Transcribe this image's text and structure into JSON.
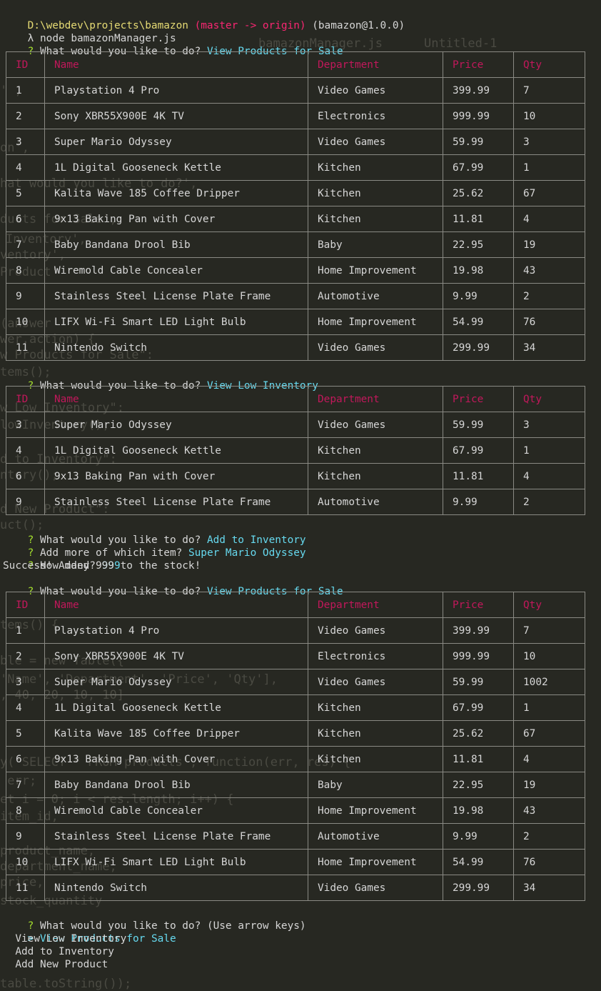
{
  "prompt": {
    "path": "D:\\webdev\\projects\\bamazon",
    "branch": "(master -> origin)",
    "package": "(bamazon@1.0.0)",
    "symbol": "λ",
    "command": "node bamazonManager.js"
  },
  "ghost_tabs": [
    "bamazonManager.js",
    "Untitled-1"
  ],
  "columns": [
    "ID",
    "Name",
    "Department",
    "Price",
    "Qty"
  ],
  "q_mark": "?",
  "sessions": {
    "q1": {
      "question": "What would you like to do?",
      "answer": "View Products for Sale"
    },
    "q2": {
      "question": "What would you like to do?",
      "answer": "View Low Inventory"
    },
    "q3": {
      "question": "What would you like to do?",
      "answer": "Add to Inventory"
    },
    "q4": {
      "question": "Add more of which item?",
      "answer": "Super Mario Odyssey"
    },
    "q5": {
      "question": "How many?",
      "answer": "999"
    },
    "success": "Success! Added 999 to the stock!",
    "q6": {
      "question": "What would you like to do?",
      "answer": "View Products for Sale"
    },
    "q7": {
      "question": "What would you like to do?",
      "hint": "(Use arrow keys)"
    }
  },
  "tables": {
    "products_1": [
      [
        "1",
        "Playstation 4 Pro",
        "Video Games",
        "399.99",
        "7"
      ],
      [
        "2",
        "Sony XBR55X900E 4K TV",
        "Electronics",
        "999.99",
        "10"
      ],
      [
        "3",
        "Super Mario Odyssey",
        "Video Games",
        "59.99",
        "3"
      ],
      [
        "4",
        "1L Digital Gooseneck Kettle",
        "Kitchen",
        "67.99",
        "1"
      ],
      [
        "5",
        "Kalita Wave 185 Coffee Dripper",
        "Kitchen",
        "25.62",
        "67"
      ],
      [
        "6",
        "9x13 Baking Pan with Cover",
        "Kitchen",
        "11.81",
        "4"
      ],
      [
        "7",
        "Baby Bandana Drool Bib",
        "Baby",
        "22.95",
        "19"
      ],
      [
        "8",
        "Wiremold Cable Concealer",
        "Home Improvement",
        "19.98",
        "43"
      ],
      [
        "9",
        "Stainless Steel License Plate Frame",
        "Automotive",
        "9.99",
        "2"
      ],
      [
        "10",
        "LIFX Wi-Fi Smart LED Light Bulb",
        "Home Improvement",
        "54.99",
        "76"
      ],
      [
        "11",
        "Nintendo Switch",
        "Video Games",
        "299.99",
        "34"
      ]
    ],
    "low_inventory": [
      [
        "3",
        "Super Mario Odyssey",
        "Video Games",
        "59.99",
        "3"
      ],
      [
        "4",
        "1L Digital Gooseneck Kettle",
        "Kitchen",
        "67.99",
        "1"
      ],
      [
        "6",
        "9x13 Baking Pan with Cover",
        "Kitchen",
        "11.81",
        "4"
      ],
      [
        "9",
        "Stainless Steel License Plate Frame",
        "Automotive",
        "9.99",
        "2"
      ]
    ],
    "products_2": [
      [
        "1",
        "Playstation 4 Pro",
        "Video Games",
        "399.99",
        "7"
      ],
      [
        "2",
        "Sony XBR55X900E 4K TV",
        "Electronics",
        "999.99",
        "10"
      ],
      [
        "3",
        "Super Mario Odyssey",
        "Video Games",
        "59.99",
        "1002"
      ],
      [
        "4",
        "1L Digital Gooseneck Kettle",
        "Kitchen",
        "67.99",
        "1"
      ],
      [
        "5",
        "Kalita Wave 185 Coffee Dripper",
        "Kitchen",
        "25.62",
        "67"
      ],
      [
        "6",
        "9x13 Baking Pan with Cover",
        "Kitchen",
        "11.81",
        "4"
      ],
      [
        "7",
        "Baby Bandana Drool Bib",
        "Baby",
        "22.95",
        "19"
      ],
      [
        "8",
        "Wiremold Cable Concealer",
        "Home Improvement",
        "19.98",
        "43"
      ],
      [
        "9",
        "Stainless Steel License Plate Frame",
        "Automotive",
        "9.99",
        "2"
      ],
      [
        "10",
        "LIFX Wi-Fi Smart LED Light Bulb",
        "Home Improvement",
        "54.99",
        "76"
      ],
      [
        "11",
        "Nintendo Switch",
        "Video Games",
        "299.99",
        "34"
      ]
    ]
  },
  "menu": {
    "pointer": ">",
    "options": [
      "View Products for Sale",
      "View Low Inventory",
      "Add to Inventory",
      "Add New Product"
    ]
  },
  "ghost_code": [
    "' ,",
    "on',",
    "hat would you like to do?',",
    "ducts for Sale',",
    "Inventory',",
    "ventory',",
    "Product'",
    "(answer",
    "wer.action) {",
    "w Products for Sale\":",
    "tems();",
    "w Low Inventory\":",
    "lowInventory();",
    "d to Inventory\":",
    "ntory();",
    "d New Product\":",
    "uct();",
    "tems() {",
    "ble = new Table({",
    "'Name', 'Department', 'Price', 'Qty'],",
    ", 40, 20, 10, 10]",
    "y('SELECT * FROM products', function(err, res) {",
    " err;",
    "et i = 0; i < res.length; i++) {",
    "item_id,",
    "product_name,",
    "department_name,",
    "price,",
    "stock_quantity",
    "table.toString());"
  ],
  "colors": {
    "background": "#272822",
    "text": "#d6d6d6",
    "path": "#e6db74",
    "branch": "#f92672",
    "question_mark": "#a6e22e",
    "answer": "#66d9ef",
    "header": "#c2185b",
    "border": "#8a8a84"
  }
}
